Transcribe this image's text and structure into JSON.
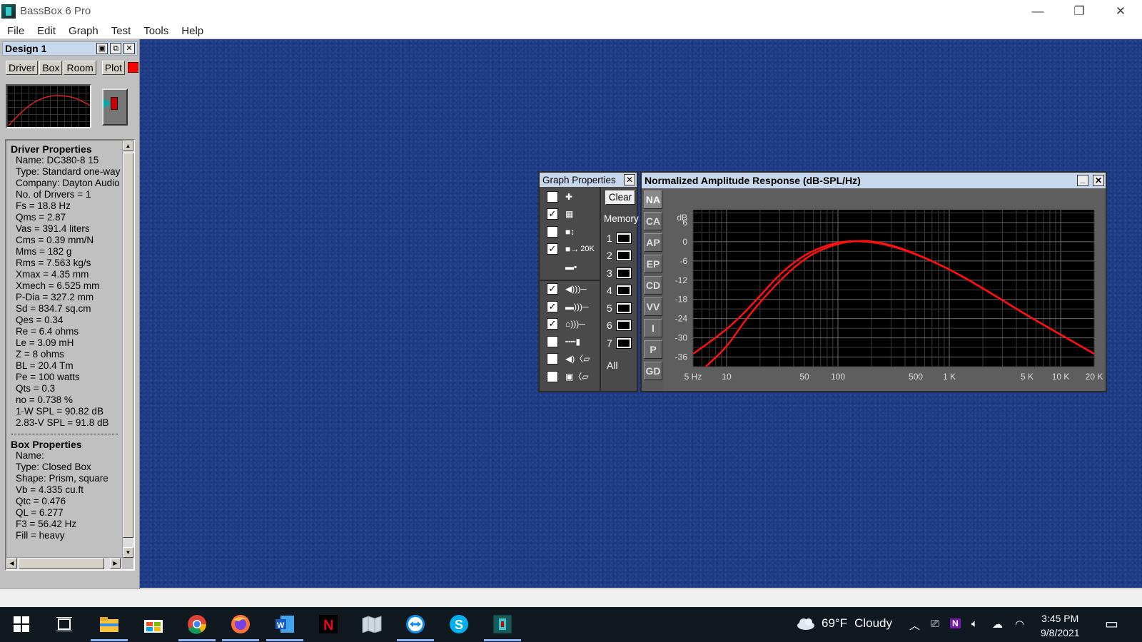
{
  "window": {
    "title": "BassBox 6 Pro",
    "minimize": "—",
    "restore": "❐",
    "close": "✕"
  },
  "menu": [
    "File",
    "Edit",
    "Graph",
    "Test",
    "Tools",
    "Help"
  ],
  "design": {
    "title": "Design 1",
    "tabs": [
      "Driver",
      "Box",
      "Room",
      "Plot"
    ],
    "plot_color": "#ff0000"
  },
  "driver_properties": {
    "heading": "Driver Properties",
    "lines": [
      "Name: DC380-8 15",
      "Type: Standard one-way (",
      "Company: Dayton Audio",
      "No. of Drivers = 1",
      "Fs = 18.8 Hz",
      "Qms = 2.87",
      "Vas = 391.4 liters",
      "Cms = 0.39 mm/N",
      "Mms = 182 g",
      "Rms = 7.563 kg/s",
      "Xmax = 4.35 mm",
      "Xmech = 6.525 mm",
      "P-Dia = 327.2 mm",
      "Sd = 834.7 sq.cm",
      "Qes = 0.34",
      "Re = 6.4 ohms",
      "Le = 3.09 mH",
      "Z = 8 ohms",
      "BL = 20.4 Tm",
      "Pe = 100 watts",
      "Qts = 0.3",
      "no = 0.738 %",
      "1-W SPL = 90.82 dB",
      "2.83-V SPL = 91.8 dB"
    ]
  },
  "box_properties": {
    "heading": "Box Properties",
    "lines": [
      "Name:",
      "Type: Closed Box",
      "Shape: Prism, square",
      "Vb = 4.335 cu.ft",
      "Qtc = 0.476",
      "QL = 6.277",
      "F3 = 56.42 Hz",
      "Fill = heavy"
    ]
  },
  "graph_properties": {
    "title": "Graph Properties",
    "clear": "Clear",
    "memory_label": "Memory",
    "memory_slots": [
      "1",
      "2",
      "3",
      "4",
      "5",
      "6",
      "7"
    ],
    "memory_all": "All",
    "options": [
      {
        "checked": false,
        "icon": "add-icon"
      },
      {
        "checked": true,
        "icon": "grid-icon"
      },
      {
        "checked": false,
        "icon": "vertical-scale-icon"
      },
      {
        "checked": true,
        "icon": "range-20k-icon",
        "label": "20K"
      },
      {
        "checked": null,
        "icon": "layout-icon"
      },
      {
        "checked": true,
        "icon": "speaker-sound-icon"
      },
      {
        "checked": true,
        "icon": "box-sound-icon"
      },
      {
        "checked": true,
        "icon": "room-sound-icon"
      },
      {
        "checked": false,
        "icon": "mic-cable-icon"
      },
      {
        "checked": false,
        "icon": "speaker-test-icon"
      },
      {
        "checked": false,
        "icon": "driver-test-icon"
      }
    ]
  },
  "response": {
    "title": "Normalized Amplitude Response (dB-SPL/Hz)",
    "side_tabs": [
      "NA",
      "CA",
      "AP",
      "EP",
      "CD",
      "VV",
      "I",
      "P",
      "GD"
    ],
    "active_tab": "NA"
  },
  "chart_data": {
    "type": "line",
    "title": "Normalized Amplitude Response (dB-SPL/Hz)",
    "x_scale": "log",
    "xlim": [
      5,
      20000
    ],
    "ylim": [
      -39,
      10
    ],
    "ylabel": "dB",
    "x_ticks": [
      {
        "v": 5,
        "label": "5 Hz"
      },
      {
        "v": 10,
        "label": "10"
      },
      {
        "v": 50,
        "label": "50"
      },
      {
        "v": 100,
        "label": "100"
      },
      {
        "v": 500,
        "label": "500"
      },
      {
        "v": 1000,
        "label": "1 K"
      },
      {
        "v": 5000,
        "label": "5 K"
      },
      {
        "v": 10000,
        "label": "10 K"
      },
      {
        "v": 20000,
        "label": "20 K"
      }
    ],
    "y_ticks": [
      {
        "v": 6,
        "label": "6"
      },
      {
        "v": 0,
        "label": "0"
      },
      {
        "v": -6,
        "label": "-6"
      },
      {
        "v": -12,
        "label": "-12"
      },
      {
        "v": -18,
        "label": "-18"
      },
      {
        "v": -24,
        "label": "-24"
      },
      {
        "v": -30,
        "label": "-30"
      },
      {
        "v": -36,
        "label": "-36"
      }
    ],
    "grid": true,
    "line_color": "#ff1010",
    "series": [
      {
        "x": [
          5,
          8,
          12,
          20,
          30,
          50,
          80,
          120,
          200,
          300,
          500,
          1000,
          2000,
          5000,
          10000,
          20000
        ],
        "y": [
          -35,
          -30,
          -25,
          -17,
          -10,
          -4,
          -1,
          0.3,
          0,
          -1.3,
          -3.8,
          -8.5,
          -14.5,
          -23,
          -29,
          -35
        ]
      },
      {
        "x": [
          6.5,
          10,
          15,
          25,
          40,
          60,
          100,
          150,
          200,
          300,
          500,
          1000,
          2000,
          5000,
          10000,
          20000
        ],
        "y": [
          -39,
          -33,
          -24,
          -15,
          -8,
          -3.5,
          -0.5,
          0.3,
          0.2,
          -1,
          -3.7,
          -8.5,
          -14.5,
          -23,
          -29,
          -35
        ]
      }
    ]
  },
  "taskbar": {
    "weather_temp": "69°F",
    "weather_cond": "Cloudy",
    "time": "3:45 PM",
    "date": "9/8/2021",
    "apps": [
      "start",
      "task-view",
      "file-explorer",
      "store",
      "chrome",
      "firefox",
      "word",
      "netflix",
      "maps-app",
      "teamviewer",
      "skype",
      "bassbox"
    ]
  }
}
